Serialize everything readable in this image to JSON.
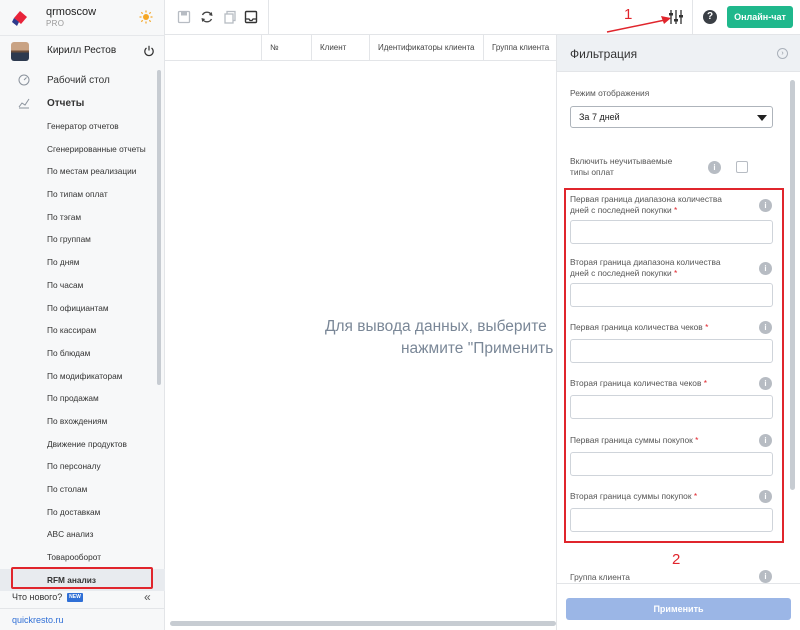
{
  "brand": {
    "name": "qrmoscow",
    "plan": "PRO"
  },
  "user": {
    "name": "Кирилл Рестов"
  },
  "nav": {
    "dashboard": "Рабочий стол",
    "reports": "Отчеты"
  },
  "reports": [
    "Генератор отчетов",
    "Сгенерированные отчеты",
    "По местам реализации",
    "По типам оплат",
    "По тэгам",
    "По группам",
    "По дням",
    "По часам",
    "По официантам",
    "По кассирам",
    "По блюдам",
    "По модификаторам",
    "По продажам",
    "По вхождениям",
    "Движение продуктов",
    "По персоналу",
    "По столам",
    "По доставкам",
    "ABC анализ",
    "Товарооборот",
    "RFM анализ"
  ],
  "footer": {
    "whats_new": "Что нового?",
    "new_badge": "NEW",
    "site": "quickresto.ru"
  },
  "toolbar": {
    "online_chat": "Онлайн-чат",
    "help": "?",
    "annotation": "1"
  },
  "table": {
    "columns": [
      "№",
      "Клиент",
      "Идентификаторы клиента",
      "Группа клиента"
    ]
  },
  "empty": {
    "line1": "Для вывода данных, выберите",
    "line2": "нажмите \"Применить"
  },
  "filter": {
    "title": "Фильтрация",
    "mode_label": "Режим отображения",
    "mode_value": "За 7 дней",
    "include_unaccounted_line1": "Включить неучитываемые",
    "include_unaccounted_line2": "типы оплат",
    "required_mark": "*",
    "fields": [
      {
        "line1": "Первая граница диапазона количества",
        "line2": "дней с последней покупки"
      },
      {
        "line1": "Вторая граница диапазона количества",
        "line2": "дней с последней покупки"
      },
      {
        "line1": "Первая граница количества чеков",
        "line2": ""
      },
      {
        "line1": "Вторая граница количества чеков",
        "line2": ""
      },
      {
        "line1": "Первая граница суммы покупок",
        "line2": ""
      },
      {
        "line1": "Вторая граница суммы покупок",
        "line2": ""
      }
    ],
    "client_group": "Группа клиента",
    "apply": "Применить",
    "annotation": "2"
  },
  "colors": {
    "accent_green": "#1fb88c",
    "highlight_red": "#e0252c",
    "apply_blue": "#9bb6e6",
    "link_blue": "#2f6fd6"
  }
}
